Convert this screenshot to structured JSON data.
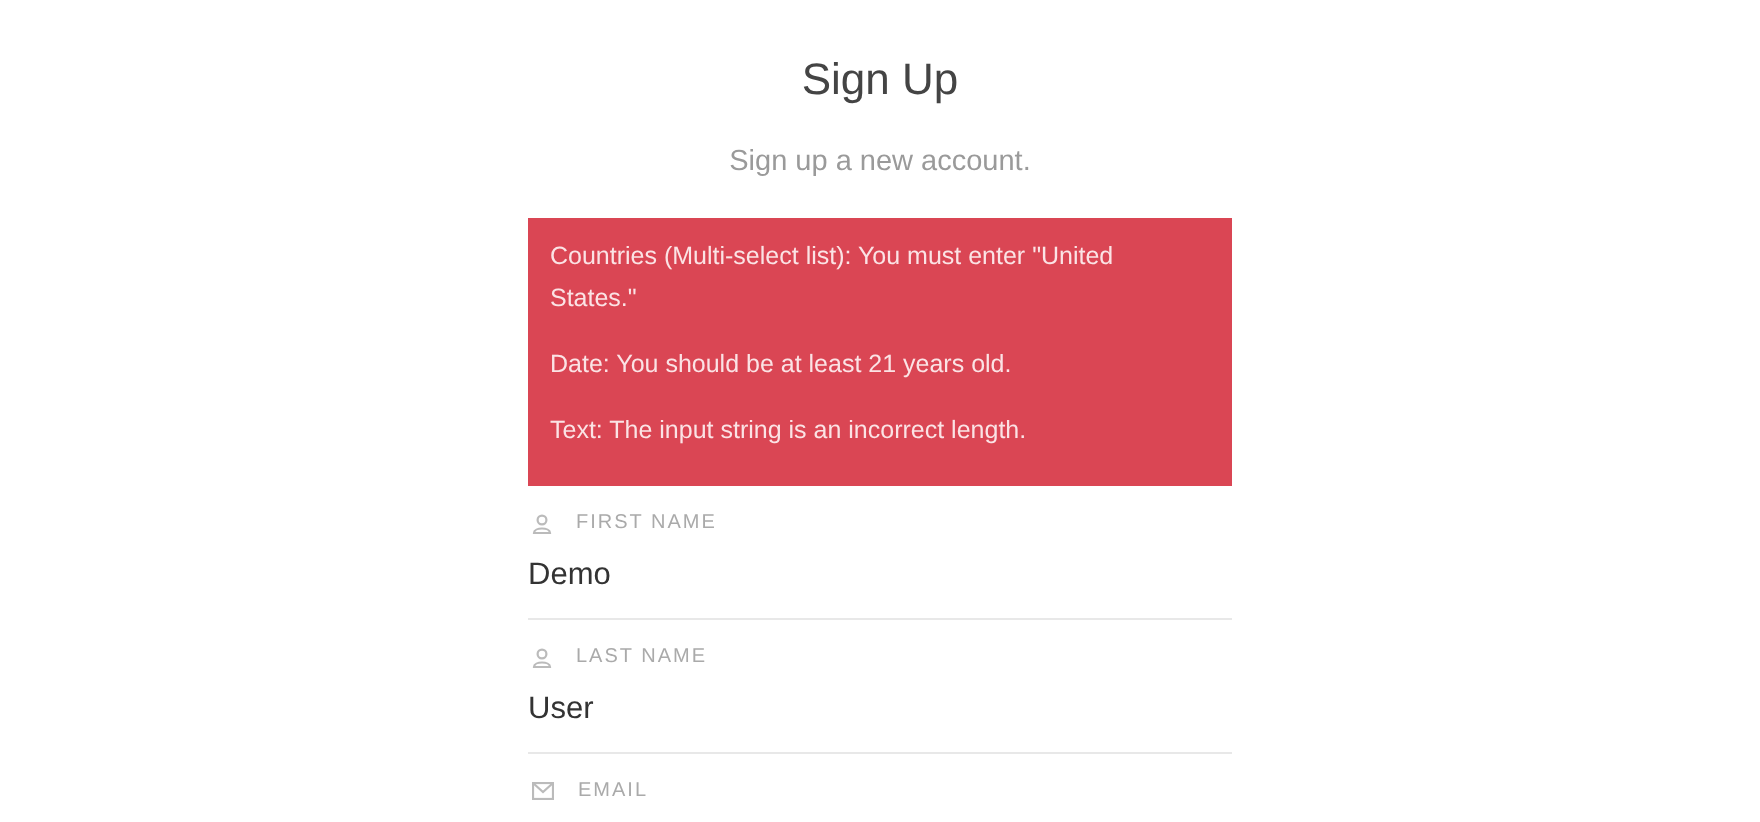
{
  "title": "Sign Up",
  "subtitle": "Sign up a new account.",
  "errors": [
    "Countries (Multi-select list): You must enter \"United States.\"",
    "Date: You should be at least 21 years old.",
    "Text: The input string is an incorrect length."
  ],
  "fields": [
    {
      "kind": "person",
      "label": "FIRST NAME",
      "value": "Demo"
    },
    {
      "kind": "person",
      "label": "LAST NAME",
      "value": "User"
    },
    {
      "kind": "mail",
      "label": "EMAIL"
    }
  ]
}
